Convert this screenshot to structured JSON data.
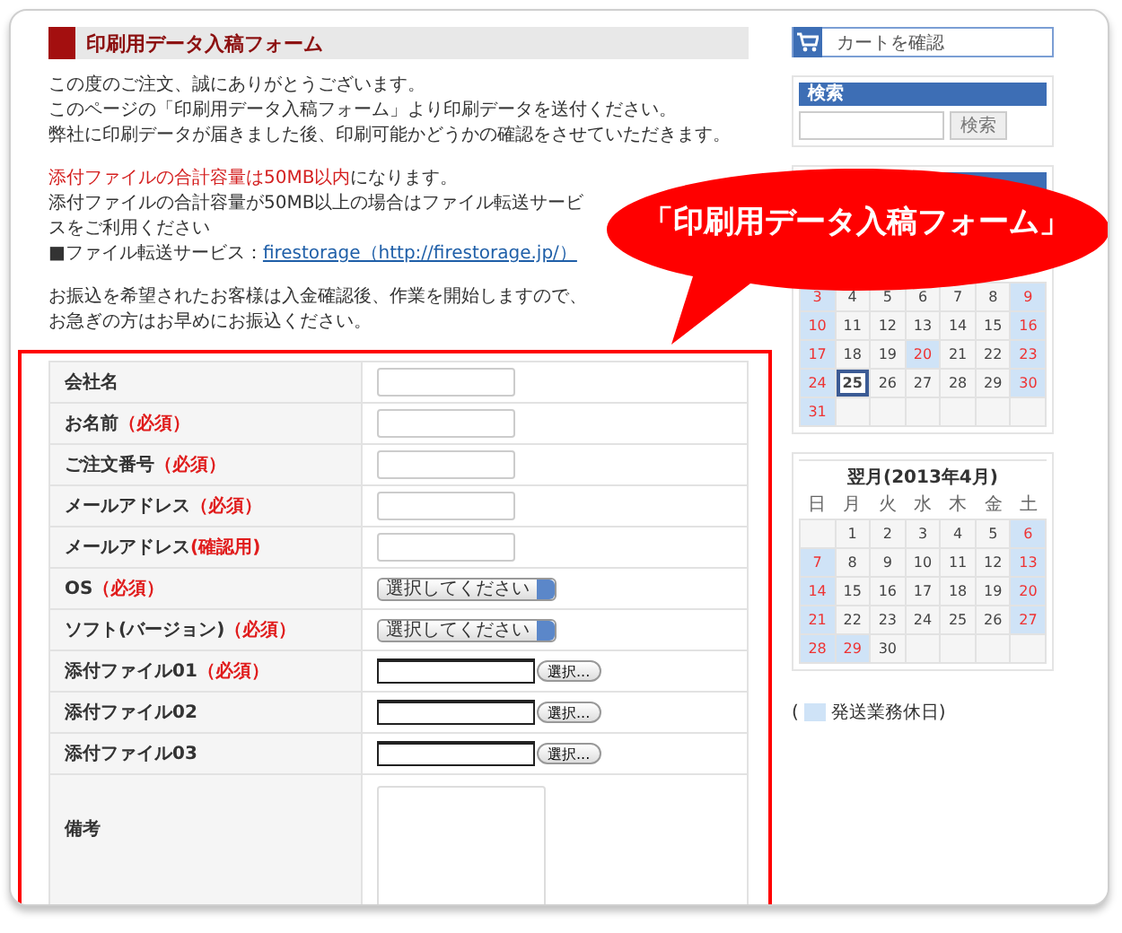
{
  "header": {
    "title": "印刷用データ入稿フォーム"
  },
  "intro": [
    {
      "lines": [
        {
          "segments": [
            {
              "kind": "plain",
              "text": "この度のご注文、誠にありがとうございます。"
            }
          ]
        },
        {
          "segments": [
            {
              "kind": "plain",
              "text": "このページの「印刷用データ入稿フォーム」より印刷データを送付ください。"
            }
          ]
        },
        {
          "segments": [
            {
              "kind": "plain",
              "text": "弊社に印刷データが届きました後、印刷可能かどうかの確認をさせていただきます。"
            }
          ]
        }
      ]
    },
    {
      "lines": [
        {
          "segments": [
            {
              "kind": "alert",
              "text": "添付ファイルの合計容量は50MB以内"
            },
            {
              "kind": "plain",
              "text": "になります。"
            }
          ]
        },
        {
          "segments": [
            {
              "kind": "plain",
              "text": "添付ファイルの合計容量が50MB以上の場合はファイル転送サービスをご利用ください"
            }
          ]
        },
        {
          "segments": [
            {
              "kind": "plain",
              "text": "■ファイル転送サービス："
            },
            {
              "kind": "link",
              "text": "firestorage（http://firestorage.jp/）"
            }
          ]
        }
      ]
    },
    {
      "lines": [
        {
          "segments": [
            {
              "kind": "plain",
              "text": "お振込を希望されたお客様は入金確認後、作業を開始しますので、"
            }
          ]
        },
        {
          "segments": [
            {
              "kind": "plain",
              "text": "お急ぎの方はお早めにお振込ください。"
            }
          ]
        }
      ]
    }
  ],
  "form": {
    "rows": [
      {
        "label": "会社名",
        "kind": "text"
      },
      {
        "label": "お名前",
        "mark": "（必須）",
        "kind": "text"
      },
      {
        "label": "ご注文番号",
        "mark": "（必須）",
        "kind": "text"
      },
      {
        "label": "メールアドレス",
        "mark": "（必須）",
        "kind": "text"
      },
      {
        "label": "メールアドレス",
        "note": "(確認用)",
        "kind": "text"
      },
      {
        "label": "OS",
        "mark": "（必須）",
        "kind": "select",
        "value": "選択してください"
      },
      {
        "label": "ソフト(バージョン)",
        "mark": "（必須）",
        "kind": "select",
        "value": "選択してください"
      },
      {
        "label": "添付ファイル01",
        "mark": "（必須）",
        "kind": "file",
        "button": "選択..."
      },
      {
        "label": "添付ファイル02",
        "kind": "file",
        "button": "選択..."
      },
      {
        "label": "添付ファイル03",
        "kind": "file",
        "button": "選択..."
      },
      {
        "label": "備考",
        "kind": "textarea"
      }
    ]
  },
  "sidebar": {
    "cart": {
      "label": "カートを確認"
    },
    "search": {
      "title": "検索",
      "button": "検索"
    },
    "calendars": [
      {
        "weeks": [
          [
            {
              "day": "3",
              "kind": "holiday"
            },
            {
              "day": "4",
              "kind": "day"
            },
            {
              "day": "5",
              "kind": "day"
            },
            {
              "day": "6",
              "kind": "day"
            },
            {
              "day": "7",
              "kind": "day"
            },
            {
              "day": "8",
              "kind": "day"
            },
            {
              "day": "9",
              "kind": "holiday"
            }
          ],
          [
            {
              "day": "10",
              "kind": "holiday"
            },
            {
              "day": "11",
              "kind": "day"
            },
            {
              "day": "12",
              "kind": "day"
            },
            {
              "day": "13",
              "kind": "day"
            },
            {
              "day": "14",
              "kind": "day"
            },
            {
              "day": "15",
              "kind": "day"
            },
            {
              "day": "16",
              "kind": "holiday"
            }
          ],
          [
            {
              "day": "17",
              "kind": "holiday"
            },
            {
              "day": "18",
              "kind": "day"
            },
            {
              "day": "19",
              "kind": "day"
            },
            {
              "day": "20",
              "kind": "holiday"
            },
            {
              "day": "21",
              "kind": "day"
            },
            {
              "day": "22",
              "kind": "day"
            },
            {
              "day": "23",
              "kind": "holiday"
            }
          ],
          [
            {
              "day": "24",
              "kind": "holiday"
            },
            {
              "day": "25",
              "kind": "today"
            },
            {
              "day": "26",
              "kind": "day"
            },
            {
              "day": "27",
              "kind": "day"
            },
            {
              "day": "28",
              "kind": "day"
            },
            {
              "day": "29",
              "kind": "day"
            },
            {
              "day": "30",
              "kind": "holiday"
            }
          ],
          [
            {
              "day": "31",
              "kind": "holiday"
            },
            {
              "kind": "blank"
            },
            {
              "kind": "blank"
            },
            {
              "kind": "blank"
            },
            {
              "kind": "blank"
            },
            {
              "kind": "blank"
            },
            {
              "kind": "blank"
            }
          ]
        ]
      },
      {
        "title": "翌月(2013年4月)",
        "weekdays": [
          "日",
          "月",
          "火",
          "水",
          "木",
          "金",
          "土"
        ],
        "weeks": [
          [
            {
              "kind": "blank"
            },
            {
              "day": "1",
              "kind": "day"
            },
            {
              "day": "2",
              "kind": "day"
            },
            {
              "day": "3",
              "kind": "day"
            },
            {
              "day": "4",
              "kind": "day"
            },
            {
              "day": "5",
              "kind": "day"
            },
            {
              "day": "6",
              "kind": "holiday"
            }
          ],
          [
            {
              "day": "7",
              "kind": "holiday"
            },
            {
              "day": "8",
              "kind": "day"
            },
            {
              "day": "9",
              "kind": "day"
            },
            {
              "day": "10",
              "kind": "day"
            },
            {
              "day": "11",
              "kind": "day"
            },
            {
              "day": "12",
              "kind": "day"
            },
            {
              "day": "13",
              "kind": "holiday"
            }
          ],
          [
            {
              "day": "14",
              "kind": "holiday"
            },
            {
              "day": "15",
              "kind": "day"
            },
            {
              "day": "16",
              "kind": "day"
            },
            {
              "day": "17",
              "kind": "day"
            },
            {
              "day": "18",
              "kind": "day"
            },
            {
              "day": "19",
              "kind": "day"
            },
            {
              "day": "20",
              "kind": "holiday"
            }
          ],
          [
            {
              "day": "21",
              "kind": "holiday"
            },
            {
              "day": "22",
              "kind": "day"
            },
            {
              "day": "23",
              "kind": "day"
            },
            {
              "day": "24",
              "kind": "day"
            },
            {
              "day": "25",
              "kind": "day"
            },
            {
              "day": "26",
              "kind": "day"
            },
            {
              "day": "27",
              "kind": "holiday"
            }
          ],
          [
            {
              "day": "28",
              "kind": "holiday"
            },
            {
              "day": "29",
              "kind": "holiday"
            },
            {
              "day": "30",
              "kind": "day"
            },
            {
              "kind": "blank"
            },
            {
              "kind": "blank"
            },
            {
              "kind": "blank"
            },
            {
              "kind": "blank"
            }
          ]
        ]
      }
    ],
    "legend": {
      "open": "(",
      "label": "発送業務休日)"
    }
  },
  "callout": {
    "text": "「印刷用データ入稿フォーム」"
  }
}
